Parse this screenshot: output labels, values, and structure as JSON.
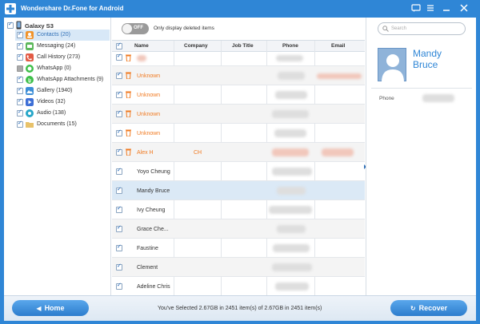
{
  "window": {
    "title": "Wondershare Dr.Fone for Android",
    "controls": [
      "chat-icon",
      "menu-icon",
      "minimize-icon",
      "close-icon"
    ]
  },
  "sidebar": {
    "device": "Galaxy S3",
    "items": [
      {
        "label": "Contacts (20)",
        "icon": "contacts-icon",
        "selected": true
      },
      {
        "label": "Messaging (24)",
        "icon": "messaging-icon"
      },
      {
        "label": "Call History (273)",
        "icon": "call-history-icon"
      },
      {
        "label": "WhatsApp (0)",
        "icon": "whatsapp-icon",
        "checkbox": "disabled"
      },
      {
        "label": "WhatsApp Attachments (9)",
        "icon": "whatsapp-attachments-icon"
      },
      {
        "label": "Gallery (1940)",
        "icon": "gallery-icon"
      },
      {
        "label": "Videos (32)",
        "icon": "videos-icon"
      },
      {
        "label": "Audio (138)",
        "icon": "audio-icon"
      },
      {
        "label": "Documents (15)",
        "icon": "documents-icon"
      }
    ]
  },
  "toolbar": {
    "toggle_state": "OFF",
    "toggle_label": "Only display deleted items"
  },
  "table": {
    "headers": {
      "name": "Name",
      "company": "Company",
      "job_title": "Job Title",
      "phone": "Phone",
      "email": "Email"
    },
    "rows": [
      {
        "name": "",
        "deleted": true,
        "company": ""
      },
      {
        "name": "Unknown",
        "deleted": true,
        "company": ""
      },
      {
        "name": "Unknown",
        "deleted": true,
        "company": ""
      },
      {
        "name": "Unknown",
        "deleted": true,
        "company": ""
      },
      {
        "name": "Unknown",
        "deleted": true,
        "company": ""
      },
      {
        "name": "Alex H",
        "deleted": true,
        "company": "CH"
      },
      {
        "name": "Yoyo Cheung",
        "deleted": false,
        "company": ""
      },
      {
        "name": "Mandy Bruce",
        "deleted": false,
        "company": "",
        "selected": true
      },
      {
        "name": "Ivy Cheung",
        "deleted": false,
        "company": ""
      },
      {
        "name": "Grace Che...",
        "deleted": false,
        "company": ""
      },
      {
        "name": "Faustine",
        "deleted": false,
        "company": ""
      },
      {
        "name": "Clement",
        "deleted": false,
        "company": ""
      },
      {
        "name": "Adeline Chris",
        "deleted": false,
        "company": ""
      }
    ]
  },
  "detail": {
    "search_placeholder": "Search",
    "name_first": "Mandy",
    "name_last": "Bruce",
    "phone_label": "Phone"
  },
  "footer": {
    "home_label": "Home",
    "recover_label": "Recover",
    "status": "You've Selected 2.67GB in 2451 item(s) of 2.67GB in 2451 item(s)"
  },
  "colors": {
    "brand_blue": "#2f86d6",
    "deleted_orange": "#f07a21",
    "selected_row": "#dbe9f6"
  }
}
